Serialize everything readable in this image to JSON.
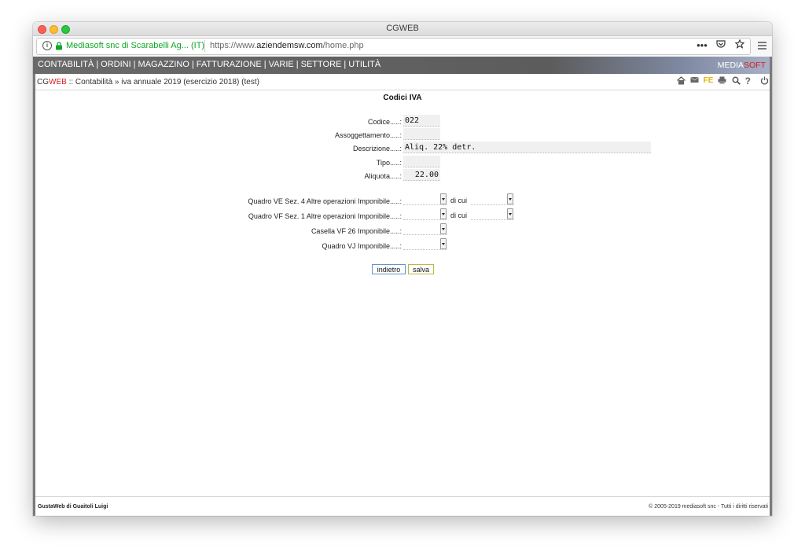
{
  "window": {
    "title": "CGWEB"
  },
  "urlbar": {
    "site_identity": "Mediasoft snc di Scarabelli Ag... (IT)",
    "url_prefix": "https://www.",
    "url_domain": "aziendemsw.com",
    "url_path": "/home.php",
    "more_label": "•••"
  },
  "menu": {
    "items": [
      "CONTABILITÀ",
      "ORDINI",
      "MAGAZZINO",
      "FATTURAZIONE",
      "VARIE",
      "SETTORE",
      "UTILITÀ"
    ],
    "separator": "|",
    "brand_a": "MEDIA",
    "brand_b": "SOFT"
  },
  "breadcrumb": {
    "app_a": "CG",
    "app_b": "WEB",
    "path": ":: Contabilità » iva annuale 2019 (esercizio 2018) (test)",
    "fe_label": "FE"
  },
  "form": {
    "title": "Codici IVA",
    "codice_label": "Codice.....:",
    "codice_value": "022",
    "assogg_label": "Assoggettamento.....:",
    "assogg_value": "",
    "descr_label": "Descrizione.....:",
    "descr_value": "Aliq. 22% detr.",
    "tipo_label": "Tipo.....:",
    "tipo_value": "",
    "aliquota_label": "Aliquota.....:",
    "aliquota_value": "22.00",
    "quadro_ve_label": "Quadro VE Sez. 4 Altre operazioni Imponibile.....:",
    "quadro_vf_label": "Quadro VF Sez. 1 Altre operazioni Imponibile.....:",
    "casella_vf_label": "Casella VF 26 Imponibile.....:",
    "quadro_vj_label": "Quadro VJ Imponibile.....:",
    "di_cui": "di cui",
    "back_button": "indietro",
    "save_button": "salva"
  },
  "footer": {
    "left": "GustaWeb di Guaitoli Luigi",
    "right": "© 2005-2019 mediasoft snc - Tutti i diritti riservati"
  },
  "colors": {
    "accent_red": "#d42020",
    "site_green": "#12a62a",
    "menubar": "#5c5c5c"
  }
}
